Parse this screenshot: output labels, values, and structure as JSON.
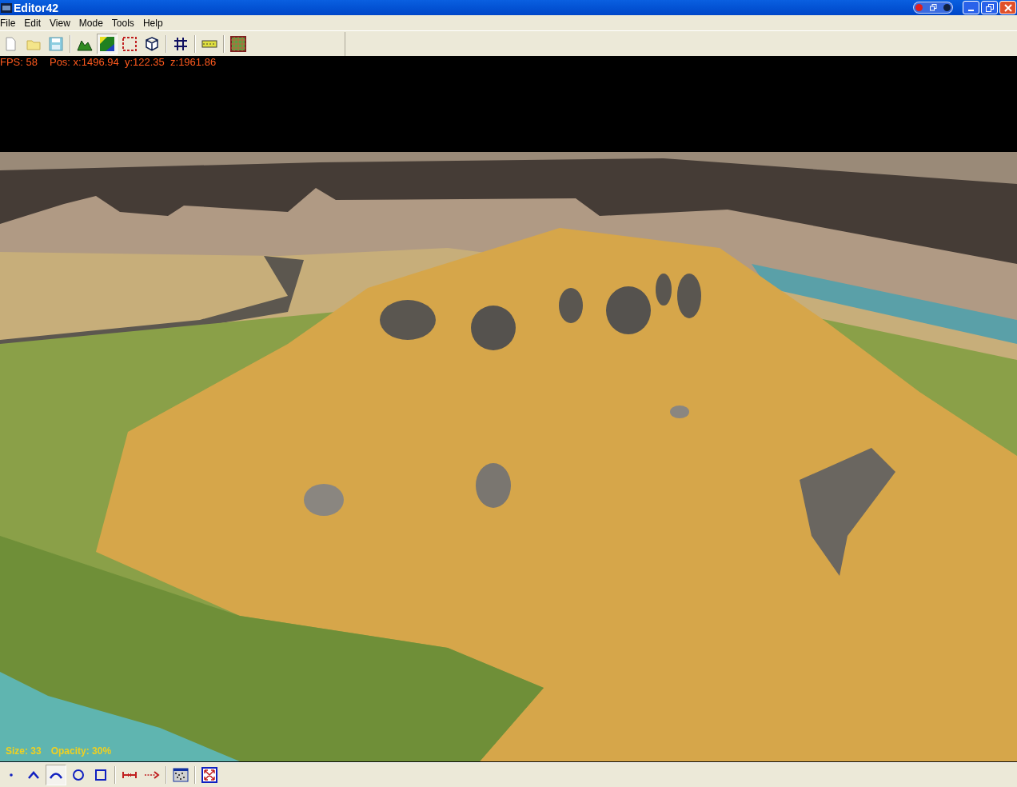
{
  "window": {
    "title": "Editor42"
  },
  "menu": [
    "File",
    "Edit",
    "View",
    "Mode",
    "Tools",
    "Help"
  ],
  "toolbar": [
    [
      {
        "kind": "new",
        "selected": false
      },
      {
        "kind": "open",
        "selected": false
      },
      {
        "kind": "save",
        "selected": false
      }
    ],
    [
      {
        "kind": "terrain",
        "selected": false
      },
      {
        "kind": "texture",
        "selected": true
      },
      {
        "kind": "selection",
        "selected": false
      },
      {
        "kind": "cube",
        "selected": false
      }
    ],
    [
      {
        "kind": "grid",
        "selected": false
      }
    ],
    [
      {
        "kind": "road",
        "selected": false
      }
    ],
    [
      {
        "kind": "tilegrid",
        "selected": false
      }
    ]
  ],
  "viewport": {
    "fps": "FPS: 58",
    "position": "Pos: x:1496.94  y:122.35  z:1961.86",
    "brush_size": "Size: 33",
    "opacity": "Opacity: 30%"
  },
  "brush_toolbar": [
    [
      {
        "kind": "dot",
        "selected": false
      },
      {
        "kind": "peak",
        "selected": false
      },
      {
        "kind": "arc",
        "selected": true
      },
      {
        "kind": "circle",
        "selected": false
      },
      {
        "kind": "square",
        "selected": false
      }
    ],
    [
      {
        "kind": "measure",
        "selected": false
      },
      {
        "kind": "arrow",
        "selected": false
      }
    ],
    [
      {
        "kind": "noise",
        "selected": false
      }
    ],
    [
      {
        "kind": "fullscreen",
        "selected": false
      }
    ]
  ]
}
